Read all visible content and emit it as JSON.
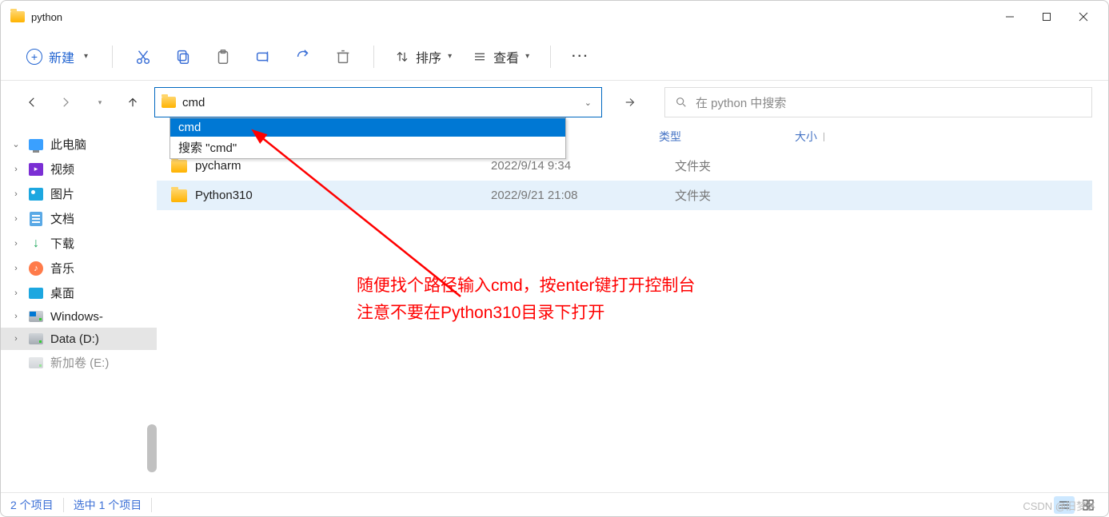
{
  "window": {
    "title": "python"
  },
  "toolbar": {
    "new_label": "新建",
    "sort_label": "排序",
    "view_label": "查看"
  },
  "address": {
    "value": "cmd",
    "dropdown": {
      "item1": "cmd",
      "item2": "搜索 \"cmd\""
    }
  },
  "search": {
    "placeholder": "在 python 中搜索"
  },
  "columns": {
    "type": "类型",
    "size": "大小"
  },
  "sidebar": {
    "this_pc": "此电脑",
    "videos": "视频",
    "pictures": "图片",
    "documents": "文档",
    "downloads": "下载",
    "music": "音乐",
    "desktop": "桌面",
    "windows_c": "Windows-",
    "data_d": "Data (D:)",
    "extra": "新加卷 (E:)"
  },
  "rows": [
    {
      "name": "pycharm",
      "date": "2022/9/14 9:34",
      "type": "文件夹"
    },
    {
      "name": "Python310",
      "date": "2022/9/21 21:08",
      "type": "文件夹"
    }
  ],
  "annotation": {
    "line1": "随便找个路径输入cmd，按enter键打开控制台",
    "line2": "注意不要在Python310目录下打开"
  },
  "status": {
    "count": "2 个项目",
    "selected": "选中 1 个项目"
  },
  "watermark": "CSDN @旧梦㐅"
}
